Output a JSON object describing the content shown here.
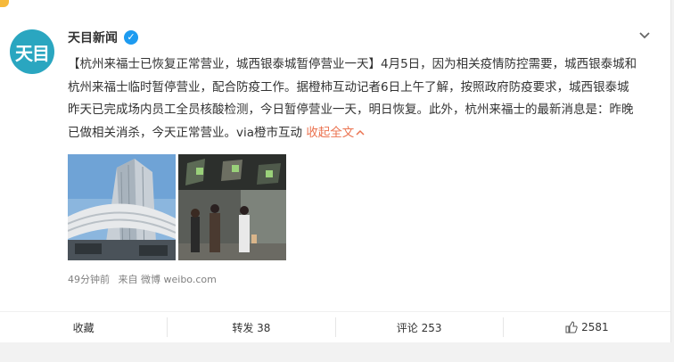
{
  "post": {
    "author": "天目新闻",
    "avatar_text": "天目",
    "content_main": "【杭州来福士已恢复正常营业，城西银泰城暂停营业一天】4月5日，因为相关疫情防控需要，城西银泰城和杭州来福士临时暂停营业，配合防疫工作。据橙柿互动记者6日上午了解，按照政府防疫要求，城西银泰城昨天已完成场内员工全员核酸检测，今日暂停营业一天，明日恢复。此外，杭州来福士的最新消息是：昨晚已做相关消杀，今天正常营业。via橙市互动 ",
    "collapse_label": "收起全文",
    "time": "49分钟前",
    "source": "来自 微博 weibo.com"
  },
  "actions": {
    "favorite": "收藏",
    "repost": "转发 38",
    "comment": "评论 253",
    "like": "2581"
  },
  "colors": {
    "link": "#eb7350",
    "avatar": "#2aa6c0",
    "verified": "#1d9bf0"
  },
  "icons": [
    "verified-icon",
    "chevron-down-icon",
    "chevron-up-icon",
    "thumbs-up-icon"
  ]
}
